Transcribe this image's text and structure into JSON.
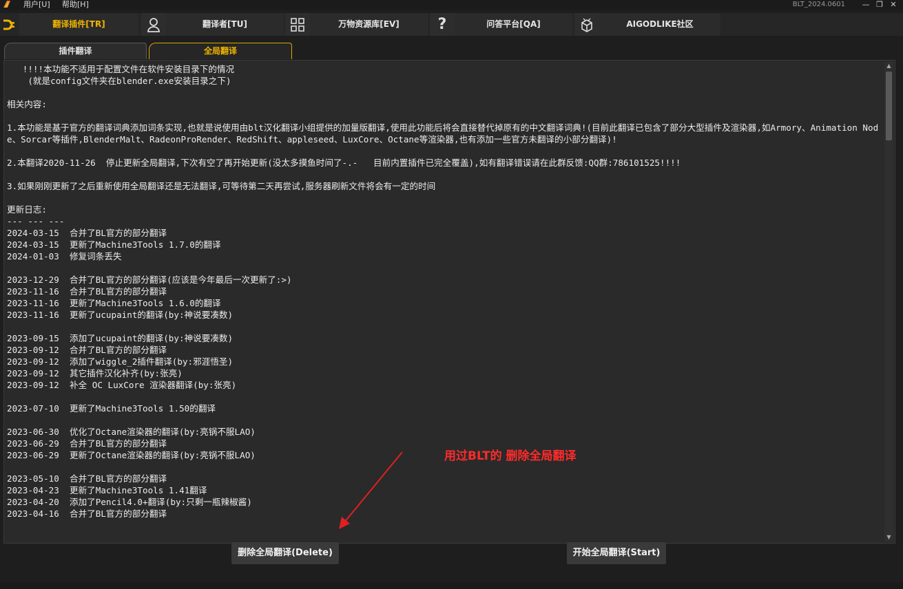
{
  "window": {
    "menu": [
      "用户[U]",
      "帮助[H]"
    ],
    "title": "BLT_2024.0601",
    "controls": {
      "minimize": "—",
      "maximize": "❐",
      "close": "✕"
    }
  },
  "topnav": [
    {
      "label": "翻译插件[TR]",
      "icon": "plug-icon",
      "active": true
    },
    {
      "label": "翻译者[TU]",
      "icon": "user-icon",
      "active": false
    },
    {
      "label": "万物资源库[EV]",
      "icon": "grid-icon",
      "active": false
    },
    {
      "label": "问答平台[QA]",
      "icon": "question-icon",
      "active": false
    },
    {
      "label": "AIGODLIKE社区",
      "icon": "package-icon",
      "active": false
    }
  ],
  "tabs": [
    {
      "label": "插件翻译",
      "active": false
    },
    {
      "label": "全局翻译",
      "active": true
    }
  ],
  "content": {
    "text": "   !!!!本功能不适用于配置文件在软件安装目录下的情况\n    (就是config文件夹在blender.exe安装目录之下)\n\n相关内容:\n\n1.本功能是基于官方的翻译词典添加词条实现,也就是说使用由blt汉化翻译小组提供的加量版翻译,使用此功能后将会直接替代掉原有的中文翻译词典!(目前此翻译已包含了部分大型插件及渲染器,如Armory、Animation Node、Sorcar等插件,BlenderMalt、RadeonProRender、RedShift、appleseed、LuxCore、Octane等渲染器,也有添加一些官方未翻译的小部分翻译)!\n\n2.本翻译2020-11-26  停止更新全局翻译,下次有空了再开始更新(没太多摸鱼时间了-.-   目前内置插件已完全覆盖),如有翻译错误请在此群反馈:QQ群:786101525!!!!\n\n3.如果刚刚更新了之后重新使用全局翻译还是无法翻译,可等待第二天再尝试,服务器刷新文件将会有一定的时间\n\n更新日志:\n--- --- ---\n2024-03-15  合并了BL官方的部分翻译\n2024-03-15  更新了Machine3Tools 1.7.0的翻译\n2024-01-03  修复词条丢失\n\n2023-12-29  合并了BL官方的部分翻译(应该是今年最后一次更新了:>)\n2023-11-16  合并了BL官方的部分翻译\n2023-11-16  更新了Machine3Tools 1.6.0的翻译\n2023-11-16  更新了ucupaint的翻译(by:神说要凑数)\n\n2023-09-15  添加了ucupaint的翻译(by:神说要凑数)\n2023-09-12  合并了BL官方的部分翻译\n2023-09-12  添加了wiggle_2插件翻译(by:邪涯悟圣)\n2023-09-12  其它插件汉化补齐(by:张亮)\n2023-09-12  补全 OC LuxCore 渲染器翻译(by:张亮)\n\n2023-07-10  更新了Machine3Tools 1.50的翻译\n\n2023-06-30  优化了Octane渲染器的翻译(by:亮锅不服LAO)\n2023-06-29  合并了BL官方的部分翻译\n2023-06-29  更新了Octane渲染器的翻译(by:亮锅不服LAO)\n\n2023-05-10  合并了BL官方的部分翻译\n2023-04-23  更新了Machine3Tools 1.41翻译\n2023-04-20  添加了Pencil4.0+翻译(by:只剩一瓶辣椒酱)\n2023-04-16  合并了BL官方的部分翻译"
  },
  "annotation": "用过BLT的  删除全局翻译",
  "buttons": {
    "delete": "删除全局翻译(Delete)",
    "start": "开始全局翻译(Start)"
  },
  "colors": {
    "accent": "#f0b400",
    "annotation": "#ff2a2a",
    "background": "#1e1e1e",
    "panel": "#2a2a2a"
  }
}
